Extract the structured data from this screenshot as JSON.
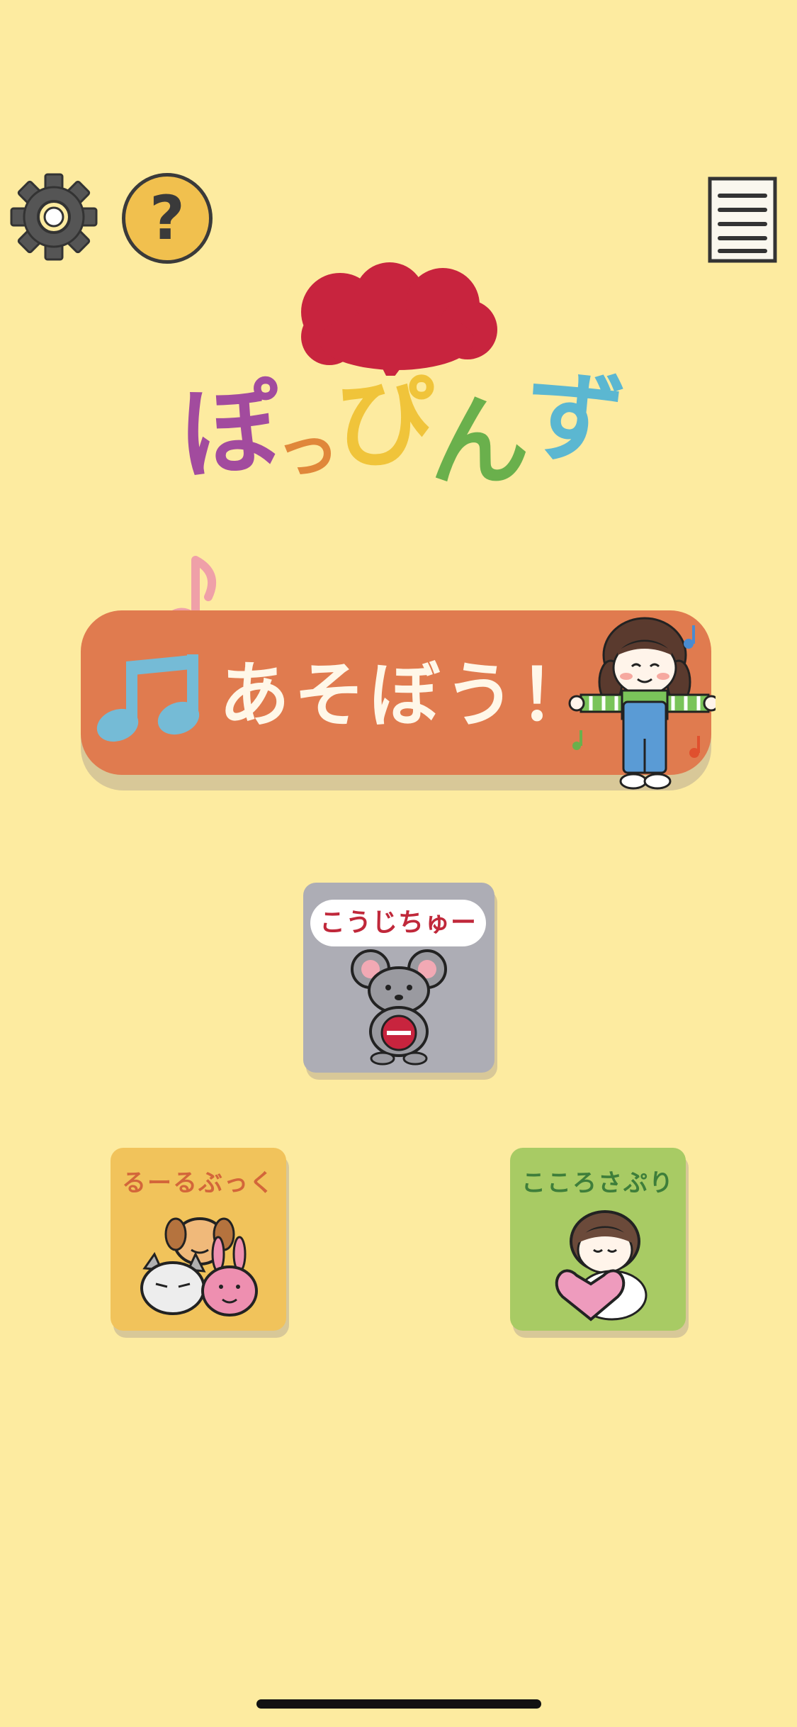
{
  "app": {
    "name": "ぽっぴんず",
    "background": "#FDEBA0"
  },
  "topbar": {
    "settings_icon": "gear-icon",
    "help_icon": "question-icon",
    "help_glyph": "?",
    "menu_icon": "document-list-icon"
  },
  "logo": {
    "title": "ぽっぴんず",
    "letters": [
      "ぽ",
      "っ",
      "ぴ",
      "ん",
      "ず"
    ],
    "letter_colors": [
      "#A24B9E",
      "#E0873A",
      "#F0C43A",
      "#6AB04C",
      "#5BB7D1"
    ],
    "cloud_color": "#C8243E"
  },
  "play": {
    "label": "あそぼう！",
    "color": "#E07B4F",
    "note_icon": "music-note-icon"
  },
  "cards": {
    "kouji": {
      "title": "こうじちゅー",
      "badge": "under-construction"
    },
    "rule": {
      "title": "るーるぶっく"
    },
    "kokoro": {
      "title": "こころさぷり"
    }
  }
}
